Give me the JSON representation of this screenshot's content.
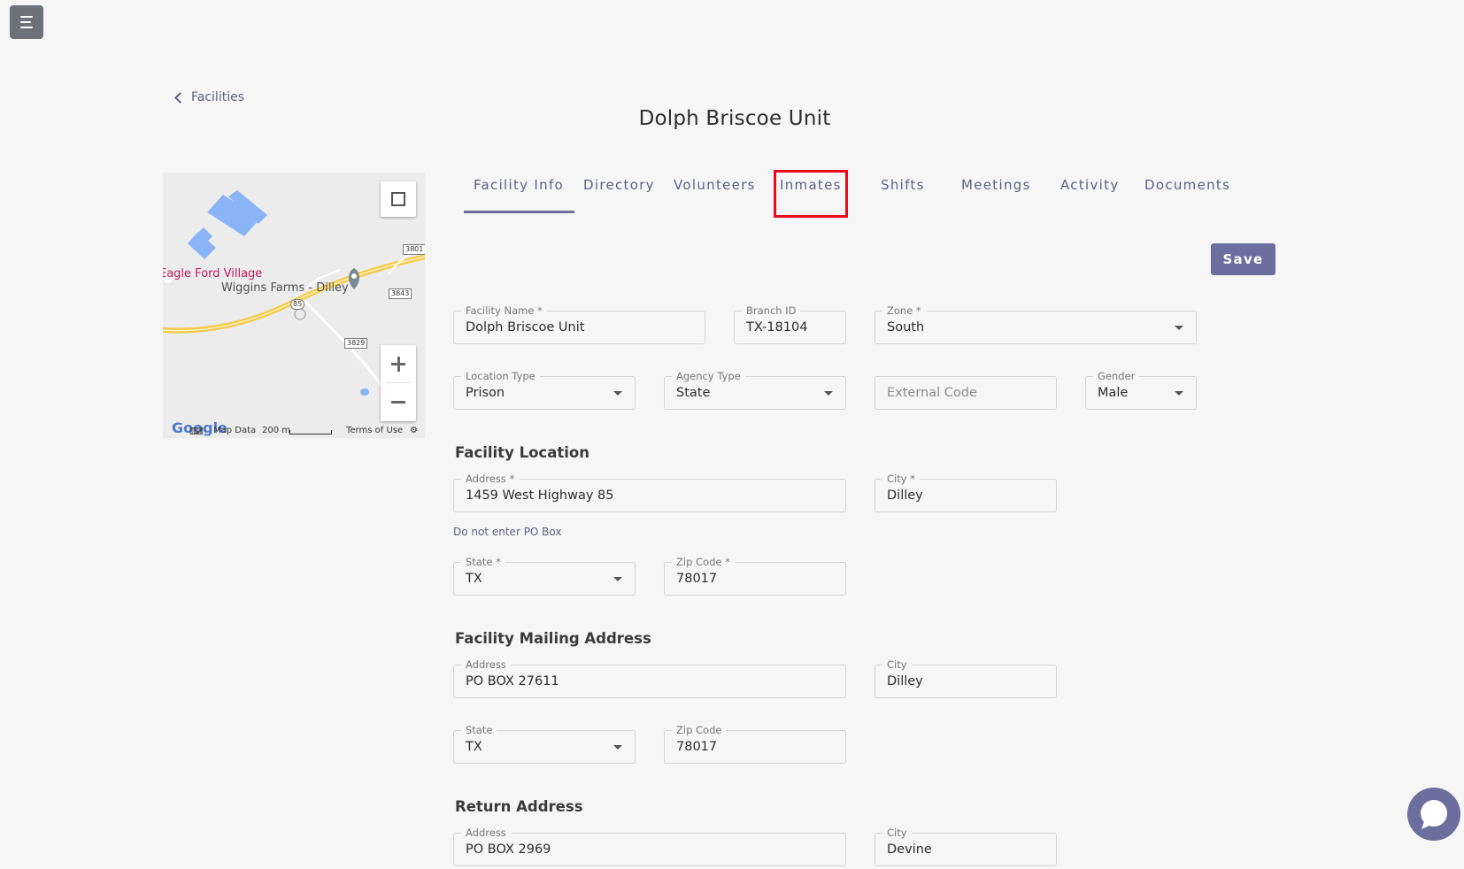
{
  "nav": {
    "back_label": "Facilities"
  },
  "page": {
    "title": "Dolph Briscoe Unit"
  },
  "map": {
    "labels": {
      "village": "Eagle Ford Village",
      "farms": "Wiggins Farms - Dilley"
    },
    "shields": [
      "3801",
      "3843",
      "85",
      "3829"
    ],
    "footer": {
      "logo": "Google",
      "map_data": "Map Data",
      "scale": "200 m",
      "terms": "Terms of Use"
    }
  },
  "tabs": [
    {
      "label": "Facility Info",
      "active": true
    },
    {
      "label": "Directory"
    },
    {
      "label": "Volunteers"
    },
    {
      "label": "Inmates",
      "highlighted": true
    },
    {
      "label": "Shifts"
    },
    {
      "label": "Meetings"
    },
    {
      "label": "Activity"
    },
    {
      "label": "Documents"
    }
  ],
  "actions": {
    "save_label": "Save"
  },
  "facility": {
    "name": {
      "label": "Facility Name *",
      "value": "Dolph Briscoe Unit"
    },
    "branch_id": {
      "label": "Branch ID",
      "value": "TX-18104"
    },
    "zone": {
      "label": "Zone *",
      "value": "South"
    },
    "location_type": {
      "label": "Location Type",
      "value": "Prison"
    },
    "agency_type": {
      "label": "Agency Type",
      "value": "State"
    },
    "external_code": {
      "placeholder": "External Code"
    },
    "gender": {
      "label": "Gender",
      "value": "Male"
    }
  },
  "location": {
    "title": "Facility Location",
    "address": {
      "label": "Address *",
      "value": "1459 West Highway 85"
    },
    "city": {
      "label": "City *",
      "value": "Dilley"
    },
    "helper": "Do not enter PO Box",
    "state": {
      "label": "State *",
      "value": "TX"
    },
    "zip": {
      "label": "Zip Code *",
      "value": "78017"
    }
  },
  "mailing": {
    "title": "Facility Mailing Address",
    "address": {
      "label": "Address",
      "value": "PO BOX 27611"
    },
    "city": {
      "label": "City",
      "value": "Dilley"
    },
    "state": {
      "label": "State",
      "value": "TX"
    },
    "zip": {
      "label": "Zip Code",
      "value": "78017"
    }
  },
  "return_address": {
    "title": "Return Address",
    "address": {
      "label": "Address",
      "value": "PO BOX 2969"
    },
    "city": {
      "label": "City",
      "value": "Devine"
    }
  },
  "colors": {
    "accent": "#6c6f9d",
    "highlight": "#e8091b",
    "road": "#f7c948",
    "building": "#8ab4f8"
  }
}
